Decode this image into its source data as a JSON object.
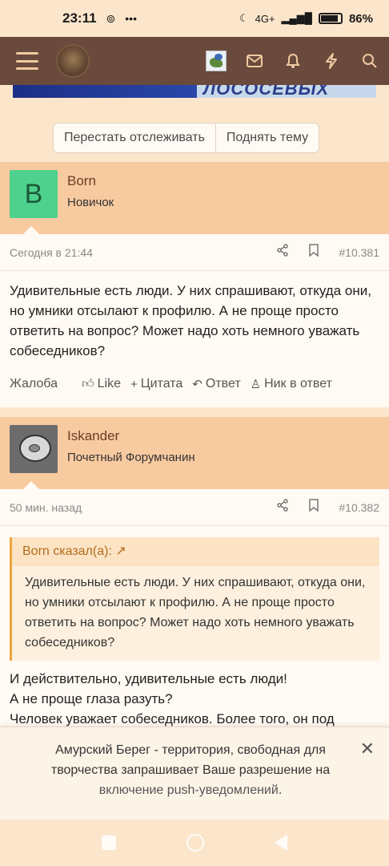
{
  "status_bar": {
    "time": "23:11",
    "battery_percent": "86",
    "network": "4G+"
  },
  "banner": {
    "text": "ЛОСОСЕВЫХ"
  },
  "thread_actions": {
    "unwatch": "Перестать отслеживать",
    "bump": "Поднять тему"
  },
  "posts": [
    {
      "avatar_letter": "B",
      "author": "Born",
      "role": "Новичок",
      "time": "Сегодня в 21:44",
      "number": "#10.381",
      "text": "Удивительные есть люди. У них спрашивают, откуда они, но умники отсылают к профилю. А не проще просто ответить на вопрос? Может надо хоть немного уважать собеседников?",
      "actions": {
        "report": "Жалоба",
        "like": "Like",
        "quote": "Цитата",
        "reply": "Ответ",
        "mention": "Ник в ответ"
      }
    },
    {
      "author": "Iskander",
      "role": "Почетный Форумчанин",
      "time": "50 мин. назад",
      "number": "#10.382",
      "quote_header": "Born сказал(а):",
      "quote_text": "Удивительные есть люди. У них спрашивают, откуда они, но умники отсылают к профилю. А не проще просто ответить на вопрос? Может надо хоть немного уважать собеседников?",
      "text_lines": [
        "И действительно, удивительные есть люди!",
        "А не проще глаза разуть?",
        "Человек уважает собеседников. Более того, он под"
      ]
    }
  ],
  "push_notice": {
    "message": "Амурский Берег - территория, свободная для творчества запрашивает Ваше разрешение на",
    "link_text": "включение push-уведомлений",
    "end": "."
  }
}
